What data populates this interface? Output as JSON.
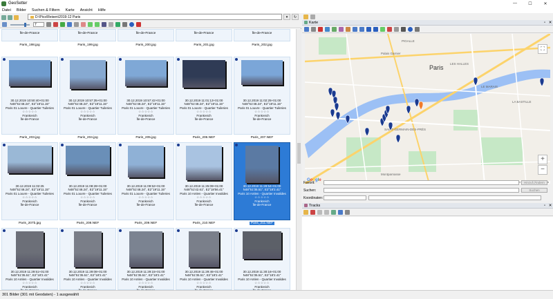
{
  "window": {
    "title": "GeoSetter"
  },
  "window_controls": [
    "—",
    "☐",
    "✕"
  ],
  "menu": [
    "Datei",
    "Bilder",
    "Suchen & Filtern",
    "Karte",
    "Ansicht",
    "Hilfe"
  ],
  "path": {
    "value": "D:\\Pics\\Reisen\\2019-12 Paris"
  },
  "zoom": {
    "value": "7"
  },
  "top_row": [
    {
      "country": "Île-de-France",
      "file": "Paris_198.jpg"
    },
    {
      "country": "Île-de-France",
      "file": "Paris_199.jpg"
    },
    {
      "country": "Île-de-France",
      "file": "Paris_200.jpg"
    },
    {
      "country": "Île-de-France",
      "file": "Paris_201.jpg"
    },
    {
      "country": "Île-de-France",
      "file": "Paris_202.jpg"
    }
  ],
  "grid_rows": [
    [
      {
        "date": "30.12.2019 10:50:40+01:00",
        "coords": "N48°51'48.24\", E2°19'11.15\"",
        "place": "Paris 01 Louvre - Quartier Tuileries",
        "country": "Frankreich",
        "region": "Île-de-France",
        "file": "Paris_203.jpg",
        "stars": "☆☆☆☆☆"
      },
      {
        "date": "30.12.2019 10:57:35+01:00",
        "coords": "N48°51'48.24\", E2°19'11.15\"",
        "place": "Paris 01 Louvre - Quartier Tuileries",
        "country": "Frankreich",
        "region": "Île-de-France",
        "file": "Paris_204.jpg",
        "stars": "☆☆☆☆☆"
      },
      {
        "date": "30.12.2019 10:57:42+01:00",
        "coords": "N48°51'48.24\", E2°19'11.15\"",
        "place": "Paris 01 Louvre - Quartier Tuileries",
        "country": "Frankreich",
        "region": "Île-de-France",
        "file": "Paris_205.jpg",
        "stars": "☆☆☆☆☆"
      },
      {
        "date": "30.12.2019 11:01:13+01:00",
        "coords": "N48°51'48.24\", E2°19'11.15\"",
        "place": "Paris 01 Louvre - Quartier Tuileries",
        "country": "Frankreich",
        "region": "Île-de-France",
        "file": "Paris_206.NEF",
        "stars": "☆☆☆☆☆"
      },
      {
        "date": "30.12.2019 11:02:25+01:00",
        "coords": "N48°51'48.24\", E2°19'11.15\"",
        "place": "Paris 01 Louvre - Quartier Tuileries",
        "country": "Frankreich",
        "region": "Île-de-France",
        "file": "Paris_207.NEF",
        "stars": "☆☆☆☆☆"
      }
    ],
    [
      {
        "date": "30.12.2019 11:02:25",
        "coords": "N48°51'48.24\", E2°19'11.15\"",
        "place": "Paris 01 Louvre - Quartier Tuileries",
        "country": "Frankreich",
        "region": "Île-de-France",
        "file": "Paris_207b.jpg",
        "stars": "☆☆☆☆☆"
      },
      {
        "date": "30.12.2019 11:08:28+01:00",
        "coords": "N48°51'48.24\", E2°19'11.15\"",
        "place": "Paris 01 Louvre - Quartier Tuileries",
        "country": "Frankreich",
        "region": "Île-de-France",
        "file": "Paris_208.NEF",
        "stars": "☆☆☆☆☆"
      },
      {
        "date": "30.12.2019 11:09:52+01:00",
        "coords": "N48°51'48.24\", E2°19'11.15\"",
        "place": "Paris 01 Louvre - Quartier Tuileries",
        "country": "Frankreich",
        "region": "Île-de-France",
        "file": "Paris_209.NEF",
        "stars": "☆☆☆☆☆"
      },
      {
        "date": "30.12.2019 11:25:09+01:00",
        "coords": "N48°51'42.61\", E2°18'56.41\"",
        "place": "Paris 10 Amlen - Quartier Invalides",
        "country": "Frankreich",
        "region": "Île-de-France",
        "file": "Paris_210.NEF",
        "stars": "☆☆☆☆☆"
      },
      {
        "date": "30.12.2019 11:28:54+01:00",
        "coords": "N48°51'35.51\", E2°18'2.41\"",
        "place": "Paris 10 Amlen - Quartier Invalides",
        "country": "Frankreich",
        "region": "Île-de-France",
        "file": "Paris_211.NEF",
        "stars": "☆☆☆☆☆",
        "selected": true
      }
    ],
    [
      {
        "date": "30.12.2019 11:29:51+01:00",
        "coords": "N48°51'35.51\", E2°18'2.41\"",
        "place": "Paris 10 Amlen - Quartier Invalides",
        "country": "Frankreich",
        "region": "Île-de-France",
        "file": "",
        "stars": "☆☆☆☆☆"
      },
      {
        "date": "30.12.2019 11:29:08+01:00",
        "coords": "N48°51'35.51\", E2°18'2.41\"",
        "place": "Paris 10 Amlen - Quartier Invalides",
        "country": "Frankreich",
        "region": "Île-de-France",
        "file": "",
        "stars": "☆☆☆☆☆"
      },
      {
        "date": "30.12.2019 11:29:15+01:00",
        "coords": "N48°51'35.51\", E2°18'2.41\"",
        "place": "Paris 10 Amlen - Quartier Invalides",
        "country": "Frankreich",
        "region": "Île-de-France",
        "file": "",
        "stars": "☆☆☆☆☆"
      },
      {
        "date": "30.12.2019 11:29:46+01:00",
        "coords": "N48°51'35.51\", E2°18'2.41\"",
        "place": "Paris 10 Amlen - Quartier Invalides",
        "country": "Frankreich",
        "region": "Île-de-France",
        "file": "",
        "stars": "☆☆☆☆☆"
      },
      {
        "date": "30.12.2019 11:30:16+01:00",
        "coords": "N48°51'35.51\", E2°18'2.41\"",
        "place": "Paris 10 Amlen - Quartier Invalides",
        "country": "Frankreich",
        "region": "Île-de-France",
        "file": "",
        "stars": "☆☆☆☆☆"
      }
    ]
  ],
  "status": "301 Bilder (301 mit Geodaten) - 1 ausgewählt",
  "map_panel": {
    "title": "Karte",
    "zoom_in": "+",
    "zoom_out": "−",
    "fullscreen": "⛶",
    "attribution": "Karten­daten © 2020 Kartendaten  Nutzungsbedingungen  Fehler bei Google Maps melden",
    "google": [
      "G",
      "o",
      "o",
      "g",
      "l",
      "e"
    ],
    "labels": [
      "Paris",
      "PIGALLE",
      "LE MARAIS",
      "SAINT-GERMAIN-DES-PRÉS",
      "LA BASTILLE",
      "Montparnasse",
      "LES HALLES",
      "Palais Garnier"
    ]
  },
  "form": {
    "favorit_label": "Favorit:",
    "suchen_label": "Suchen:",
    "coords_label": "Koordinaten:",
    "hinzufuegen_button": "Hinzuf./Ändern",
    "suchen_button": "Suchen"
  },
  "tracks_panel": {
    "title": "Tracks"
  },
  "colors": {
    "selection": "#2d7bd6",
    "pin": "#1a3a8f",
    "river": "#9cc0f5",
    "park": "#c6e8c6"
  }
}
